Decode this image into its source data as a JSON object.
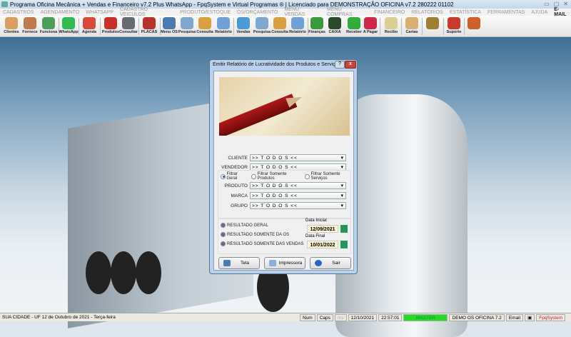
{
  "window": {
    "title": "Programa Oficina Mecânica + Vendas e Financeiro v7.2 Plus WhatsApp - FpqSystem e Virtual Programas ® | Licenciado para  DEMONSTRAÇÃO OFICINA v7.2 280222 01102"
  },
  "menu": [
    "CADASTROS",
    "AGENDAMENTO",
    "WHATSAPP",
    "CADASTRO VEICULOS",
    "PRODUTO/ESTOQUE",
    "OS/ORÇAMENTO",
    "MENU VENDAS",
    "MENU COMPRAS",
    "FINANCEIRO",
    "RELATÓRIOS",
    "ESTATÍSTICA",
    "FERRAMENTAS",
    "AJUDA",
    "E-MAIL"
  ],
  "toolbar": [
    {
      "label": "Clientes",
      "icon": "clients-icon",
      "color": "#d9a060"
    },
    {
      "label": "Fornece",
      "icon": "supplier-icon",
      "color": "#c07a50"
    },
    {
      "label": "Funciona",
      "icon": "employee-icon",
      "color": "#4aa05a"
    },
    {
      "label": "WhatsApp",
      "icon": "whatsapp-icon",
      "color": "#2dbd4e"
    },
    {
      "label": "Agenda",
      "icon": "calendar-icon",
      "color": "#d84a3a"
    },
    {
      "label": "Produtos",
      "icon": "toolbox-icon",
      "color": "#c8302a"
    },
    {
      "label": "Consultar",
      "icon": "barcode-icon",
      "color": "#666b73"
    },
    {
      "label": "PLACAS",
      "icon": "truck-icon",
      "color": "#b8332c"
    },
    {
      "label": "Menu OS",
      "icon": "clipboard-icon",
      "color": "#4a7ab0"
    },
    {
      "label": "Pesquisa",
      "icon": "search-doc-icon",
      "color": "#7fa8d0"
    },
    {
      "label": "Consulta",
      "icon": "folder-icon",
      "color": "#d9a040"
    },
    {
      "label": "Relatório",
      "icon": "printer-icon",
      "color": "#6fa0d8"
    },
    {
      "label": "Vendas",
      "icon": "monitor-icon",
      "color": "#4a9ad8"
    },
    {
      "label": "Pesquisa",
      "icon": "search-doc-icon",
      "color": "#7fa8d0"
    },
    {
      "label": "Consulta",
      "icon": "folder-icon",
      "color": "#d9a040"
    },
    {
      "label": "Relatório",
      "icon": "printer-icon",
      "color": "#6fa0d8"
    },
    {
      "label": "Finanças",
      "icon": "finance-chart-icon",
      "color": "#3a9a3a"
    },
    {
      "label": "CAIXA",
      "icon": "cash-book-icon",
      "color": "#2a4a2a"
    },
    {
      "label": "Receber",
      "icon": "dollar-green-icon",
      "color": "#2fae3a"
    },
    {
      "label": "A Pagar",
      "icon": "dollar-red-icon",
      "color": "#d0284a"
    },
    {
      "label": "Recibo",
      "icon": "receipt-icon",
      "color": "#d8d090"
    },
    {
      "label": "Cartas",
      "icon": "scroll-icon",
      "color": "#d8b070"
    },
    {
      "label": "",
      "icon": "coins-icon",
      "color": "#a08030"
    },
    {
      "label": "Suporte",
      "icon": "support-icon",
      "color": "#c83a2a"
    },
    {
      "label": "",
      "icon": "exit-door-icon",
      "color": "#d0602a"
    }
  ],
  "dialog": {
    "title": "Emitir Relatório de Lucratividade dos Produtos e Serviços",
    "cliente_label": "CLIENTE",
    "cliente_value": ">> T O D O S <<",
    "vendedor_label": "VENDEDOR",
    "vendedor_value": ">> T O D O S <<",
    "filters": [
      {
        "label": "Filtrar Geral",
        "selected": true
      },
      {
        "label": "Filtrar Somente Produtos",
        "selected": false
      },
      {
        "label": "Filtrar Somente Serviços",
        "selected": false
      }
    ],
    "produto_label": "PRODUTO",
    "produto_value": ">> T O D O S <<",
    "marca_label": "MARCA",
    "marca_value": ">> T O D O S <<",
    "grupo_label": "GRUPO",
    "grupo_value": ">> T O D O S <<",
    "results": [
      "RESULTADO GERAL",
      "RESULTADO SOMENTE DA OS",
      "RESULTADO SOMENTE DAS VENDAS"
    ],
    "data_inicial_label": "Data Inicial",
    "data_inicial": "12/09/2021",
    "data_final_label": "Data Final",
    "data_final": "10/01/2022",
    "btn_tela": "Tela",
    "btn_impressora": "Impressora",
    "btn_sair": "Sair"
  },
  "status": {
    "location": "SUA CIDADE - UF 12 de Outubro de 2021 - Terça-feira",
    "num": "Num",
    "caps": "Caps",
    "ins": "Ins",
    "date": "12/10/2021",
    "time": "22:57:01",
    "user": "MASTER",
    "company": "DEMO OS OFICINA 7.2",
    "email": "Email",
    "brand": "FpqSystem",
    "user_color": "#22dd22"
  }
}
